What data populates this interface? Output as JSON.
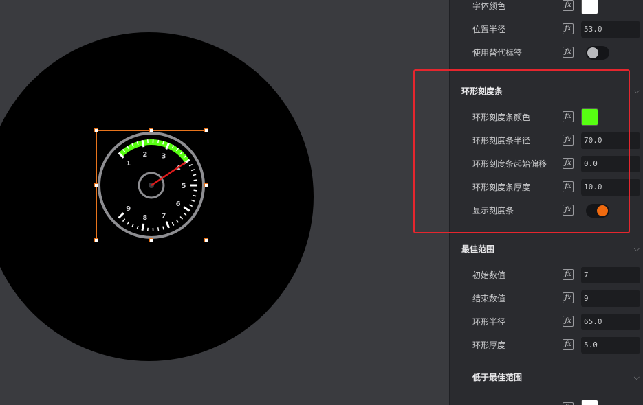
{
  "gauge": {
    "tick_labels": [
      "1",
      "2",
      "3",
      "4",
      "5",
      "6",
      "7",
      "8",
      "9"
    ],
    "arc_color": "#57ff12",
    "needle_color": "#e01b1b"
  },
  "panel": {
    "top_rows": [
      {
        "label": "字体颜色",
        "type": "color",
        "value": "#ffffff"
      },
      {
        "label": "位置半径",
        "type": "input",
        "value": "53.0"
      },
      {
        "label": "使用替代标签",
        "type": "toggle",
        "on": false
      }
    ],
    "ring_section": {
      "title": "环形刻度条",
      "rows": [
        {
          "label": "环形刻度条颜色",
          "type": "color",
          "value": "#57ff12"
        },
        {
          "label": "环形刻度条半径",
          "type": "input",
          "value": "70.0"
        },
        {
          "label": "环形刻度条起始偏移",
          "type": "input",
          "value": "0.0"
        },
        {
          "label": "环形刻度条厚度",
          "type": "input",
          "value": "10.0"
        },
        {
          "label": "显示刻度条",
          "type": "toggle",
          "on": true
        }
      ]
    },
    "best_section": {
      "title": "最佳范围",
      "rows": [
        {
          "label": "初始数值",
          "type": "input",
          "value": "7"
        },
        {
          "label": "结束数值",
          "type": "input",
          "value": "9"
        },
        {
          "label": "环形半径",
          "type": "input",
          "value": "65.0"
        },
        {
          "label": "环形厚度",
          "type": "input",
          "value": "5.0"
        }
      ]
    },
    "below_section": {
      "title": "低于最佳范围"
    },
    "fx_icon": "fx",
    "chevron": "chevron-down-icon",
    "colors": {
      "toggle_on": "#f06a0f",
      "toggle_off": "#b8b9bc",
      "highlight": "#e5262e"
    }
  }
}
